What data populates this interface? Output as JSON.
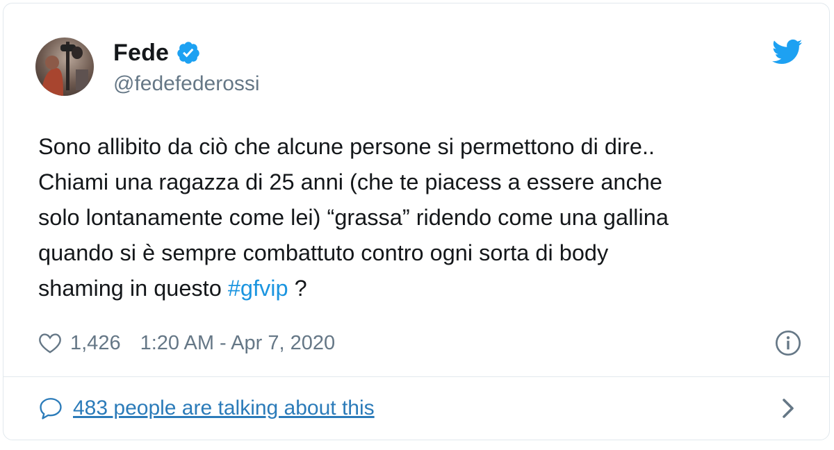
{
  "author": {
    "name": "Fede",
    "handle": "@fedefederossi",
    "verified_icon": "verified-badge-icon",
    "avatar_icon": "profile-photo"
  },
  "brand": {
    "icon": "twitter-bird-icon",
    "color": "#1da1f2"
  },
  "tweet": {
    "lines": [
      "Sono allibito da ciò che alcune persone si permettono di dire..",
      "Chiami una ragazza di 25 anni (che te piacess a essere anche",
      "solo lontanamente come lei) “grassa” ridendo come una gallina",
      "quando si è sempre combattuto contro ogni sorta di body"
    ],
    "last_line_prefix": "shaming in questo ",
    "hashtag": "#gfvip",
    "last_line_suffix": " ?",
    "hashtag_color": "#1b95e0"
  },
  "meta": {
    "likes": "1,426",
    "timestamp": "1:20 AM - Apr 7, 2020",
    "heart_icon": "heart-icon",
    "info_icon": "info-icon"
  },
  "footer": {
    "talk_label": "483 people are talking about this",
    "bubble_icon": "speech-bubble-icon",
    "chevron_icon": "chevron-right-icon",
    "link_color": "#2b7bb9"
  }
}
